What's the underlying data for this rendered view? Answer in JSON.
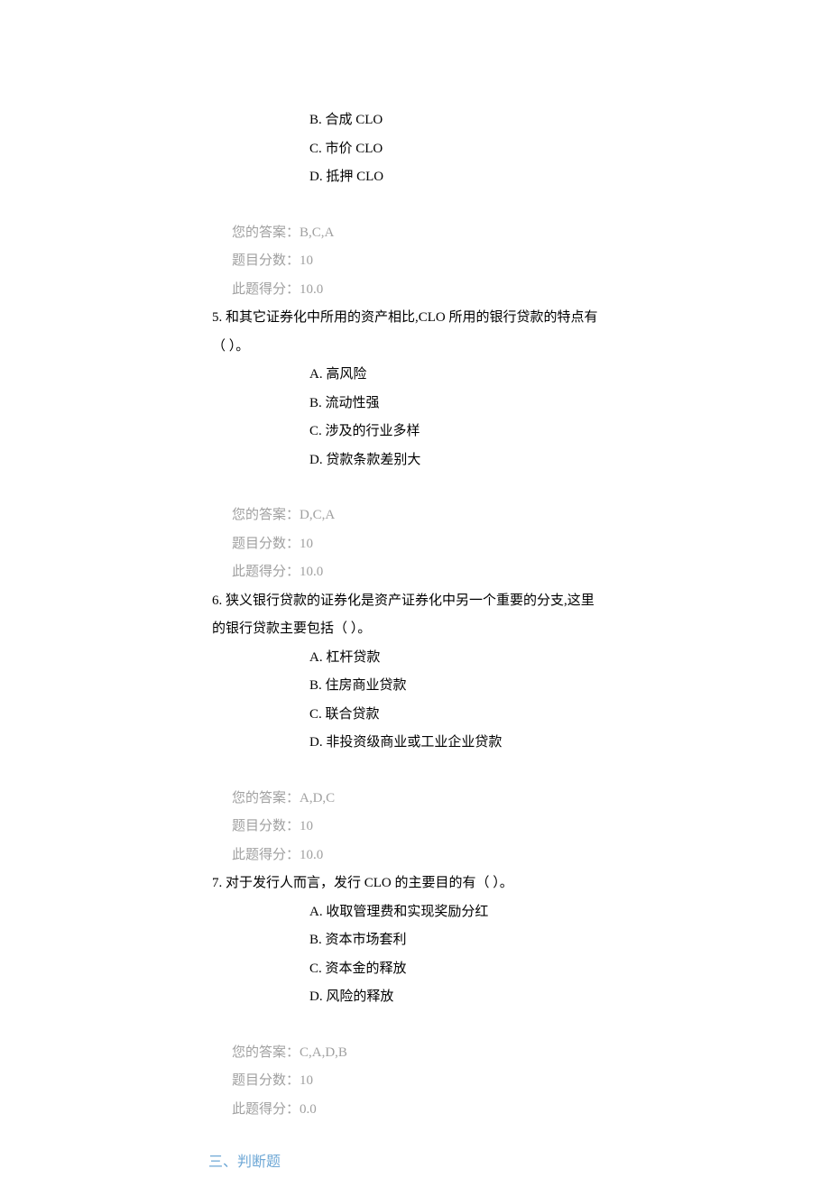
{
  "q4": {
    "opts": {
      "b": "B. 合成 CLO",
      "c": "C. 市价 CLO",
      "d": "D. 抵押 CLO"
    },
    "ans": "您的答案：B,C,A",
    "pts": "题目分数：10",
    "scr": "此题得分：10.0"
  },
  "q5": {
    "stem1": "5. 和其它证券化中所用的资产相比,CLO 所用的银行贷款的特点有",
    "stem2": "（ ）。",
    "opts": {
      "a": "A. 高风险",
      "b": "B. 流动性强",
      "c": "C. 涉及的行业多样",
      "d": "D. 贷款条款差别大"
    },
    "ans": "您的答案：D,C,A",
    "pts": "题目分数：10",
    "scr": "此题得分：10.0"
  },
  "q6": {
    "stem1": "6. 狭义银行贷款的证券化是资产证券化中另一个重要的分支,这里",
    "stem2": "的银行贷款主要包括（ ）。",
    "opts": {
      "a": "A. 杠杆贷款",
      "b": "B. 住房商业贷款",
      "c": "C. 联合贷款",
      "d": "D. 非投资级商业或工业企业贷款"
    },
    "ans": "您的答案：A,D,C",
    "pts": "题目分数：10",
    "scr": "此题得分：10.0"
  },
  "q7": {
    "stem": "7. 对于发行人而言，发行 CLO 的主要目的有（ ）。",
    "opts": {
      "a": "A. 收取管理费和实现奖励分红",
      "b": "B. 资本市场套利",
      "c": "C. 资本金的释放",
      "d": "D. 风险的释放"
    },
    "ans": "您的答案：C,A,D,B",
    "pts": "题目分数：10",
    "scr": "此题得分：0.0"
  },
  "section3": "三、判断题"
}
